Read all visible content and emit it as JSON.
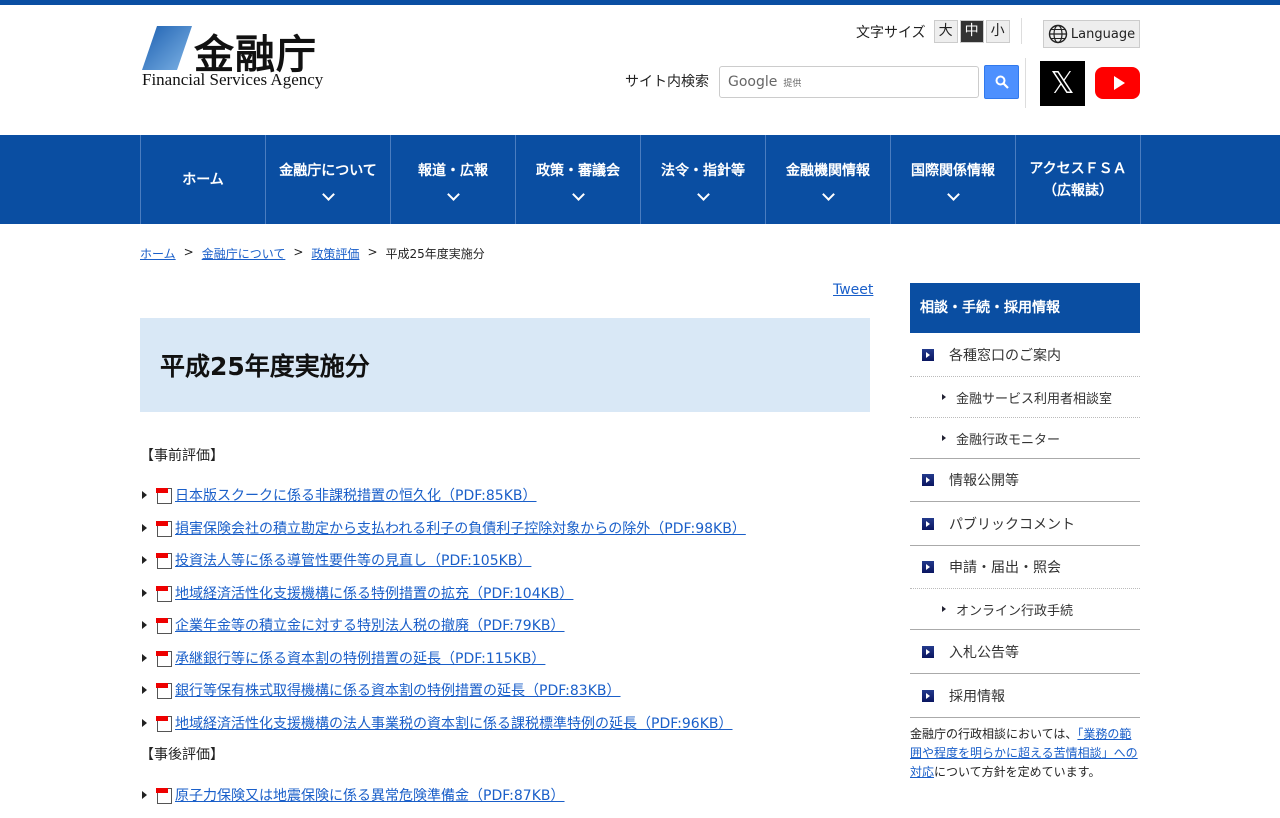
{
  "header": {
    "logo_kanji": "金融庁",
    "logo_en": "Financial Services Agency",
    "font_size_label": "文字サイズ",
    "font_sizes": [
      "大",
      "中",
      "小"
    ],
    "language": "Language",
    "search_label": "サイト内検索",
    "search_google": "Google",
    "search_provided": "提供"
  },
  "nav": [
    {
      "label": "ホーム"
    },
    {
      "label": "金融庁について"
    },
    {
      "label": "報道・広報"
    },
    {
      "label": "政策・審議会"
    },
    {
      "label": "法令・指針等"
    },
    {
      "label": "金融機関情報"
    },
    {
      "label": "国際関係情報"
    },
    {
      "label": "アクセスＦＳＡ",
      "label2": "（広報誌）"
    }
  ],
  "breadcrumb": [
    "ホーム",
    "金融庁について",
    "政策評価",
    "平成25年度実施分"
  ],
  "tweet": "Tweet",
  "title": "平成25年度実施分",
  "sections": {
    "pre": "【事前評価】",
    "post": "【事後評価】"
  },
  "pre_items": [
    "日本版スクークに係る非課税措置の恒久化（PDF:85KB）",
    "損害保険会社の積立勘定から支払われる利子の負債利子控除対象からの除外（PDF:98KB）",
    "投資法人等に係る導管性要件等の見直し（PDF:105KB）",
    "地域経済活性化支援機構に係る特例措置の拡充（PDF:104KB）",
    "企業年金等の積立金に対する特別法人税の撤廃（PDF:79KB）",
    "承継銀行等に係る資本割の特例措置の延長（PDF:115KB）",
    "銀行等保有株式取得機構に係る資本割の特例措置の延長（PDF:83KB）",
    "地域経済活性化支援機構の法人事業税の資本割に係る課税標準特例の延長（PDF:96KB）"
  ],
  "post_items": [
    "原子力保険又は地震保険に係る異常危険準備金（PDF:87KB）"
  ],
  "sidebar": {
    "heading": "相談・手続・採用情報",
    "items": [
      "各種窓口のご案内",
      "金融サービス利用者相談室",
      "金融行政モニター",
      "情報公開等",
      "パブリックコメント",
      "申請・届出・照会",
      "オンライン行政手続",
      "入札公告等",
      "採用情報"
    ],
    "note_pre": "金融庁の行政相談においては、",
    "note_link": "「業務の範囲や程度を明らかに超える苦情相談」への対応",
    "note_post": "について方針を定めています。"
  }
}
